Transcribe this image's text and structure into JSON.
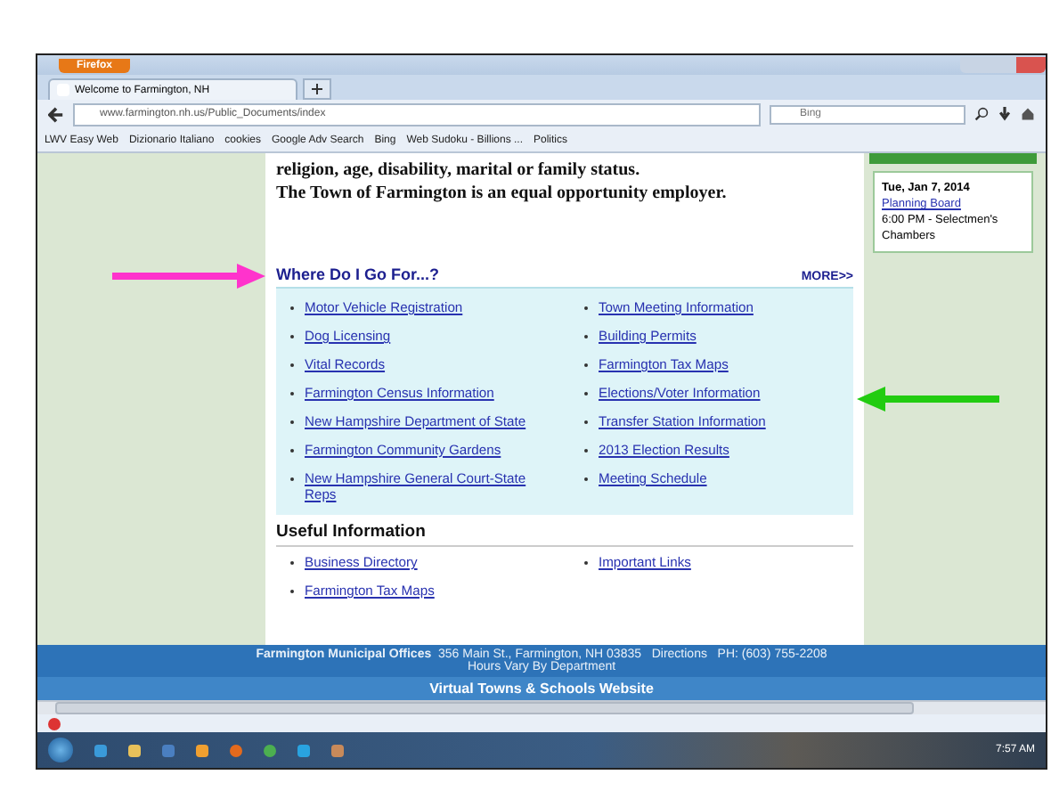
{
  "browser": {
    "menu_button": "Firefox",
    "tab": {
      "title": "Welcome to Farmington, NH"
    },
    "url": "www.farmington.nh.us/Public_Documents/index",
    "search": {
      "placeholder": "Bing"
    },
    "bookmarks": [
      "LWV Easy Web",
      "Dizionario Italiano",
      "cookies",
      "Google Adv Search",
      "Bing",
      "Web Sudoku - Billions ...",
      "Politics"
    ]
  },
  "page": {
    "notice": [
      "religion, age, disability, marital or family status.",
      "The Town of Farmington is an equal opportunity employer."
    ],
    "where_section": {
      "title": "Where Do I Go For...?",
      "more": "MORE>>",
      "links": [
        [
          "Motor Vehicle Registration",
          "Town Meeting Information"
        ],
        [
          "Dog Licensing",
          "Building Permits"
        ],
        [
          "Vital Records",
          "Farmington Tax Maps"
        ],
        [
          "Farmington Census Information",
          "Elections/Voter Information"
        ],
        [
          "New Hampshire Department of State",
          "Transfer Station Information"
        ],
        [
          "Farmington Community Gardens",
          "2013 Election Results"
        ],
        [
          "New Hampshire General Court-State Reps",
          "Meeting Schedule"
        ]
      ]
    },
    "useful_section": {
      "title": "Useful Information",
      "links": [
        [
          "Business Directory",
          "Important Links"
        ],
        [
          "Farmington Tax Maps"
        ]
      ]
    },
    "event": {
      "date": "Tue, Jan 7, 2014",
      "name": "Planning Board",
      "details": "6:00 PM - Selectmen's Chambers"
    },
    "footer": {
      "office": "Farmington Municipal Offices",
      "address": "356 Main St., Farmington, NH 03835   Directions   PH: (603) 755-2208",
      "hours": "Hours Vary By Department",
      "site_link": "Virtual Towns & Schools Website"
    }
  },
  "annotations": [
    {
      "kind": "left",
      "color": "#ff33cc"
    },
    {
      "kind": "right",
      "color": "#22cc11"
    }
  ],
  "taskbar": {
    "clock": "7:57 AM"
  }
}
